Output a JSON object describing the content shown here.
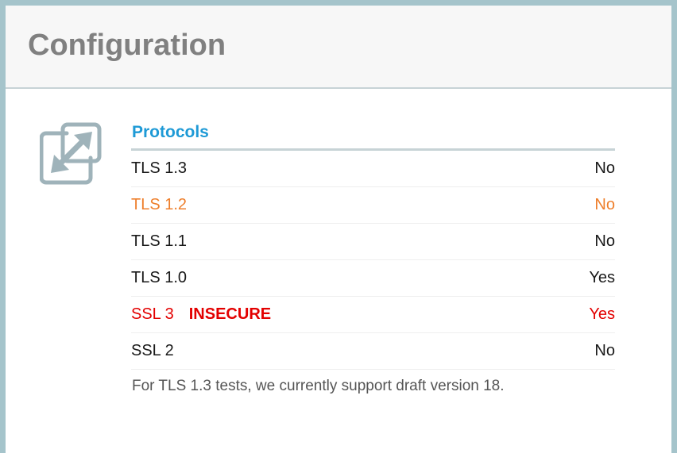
{
  "header": {
    "title": "Configuration"
  },
  "section": {
    "icon": "expand-arrows-icon",
    "title": "Protocols",
    "rows": [
      {
        "name": "TLS 1.3",
        "value": "No",
        "flag": "",
        "status": "normal"
      },
      {
        "name": "TLS 1.2",
        "value": "No",
        "flag": "",
        "status": "warning"
      },
      {
        "name": "TLS 1.1",
        "value": "No",
        "flag": "",
        "status": "normal"
      },
      {
        "name": "TLS 1.0",
        "value": "Yes",
        "flag": "",
        "status": "normal"
      },
      {
        "name": "SSL 3",
        "value": "Yes",
        "flag": "INSECURE",
        "status": "insecure"
      },
      {
        "name": "SSL 2",
        "value": "No",
        "flag": "",
        "status": "normal"
      }
    ],
    "note": "For TLS 1.3 tests, we currently support draft version 18."
  },
  "colors": {
    "page_background": "#a5c4cb",
    "title_gray": "#808080",
    "section_title_blue": "#1e9ad6",
    "warning_orange": "#ee7f2c",
    "insecure_red": "#e30000",
    "icon_gray": "#9fb3ba"
  }
}
